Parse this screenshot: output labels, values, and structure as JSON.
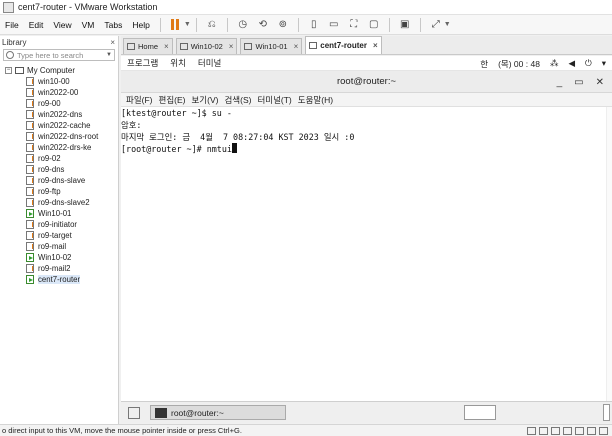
{
  "window": {
    "title": "cent7-router - VMware Workstation"
  },
  "menu": [
    "File",
    "Edit",
    "View",
    "VM",
    "Tabs",
    "Help"
  ],
  "library": {
    "title": "Library",
    "close_glyph": "×",
    "search_placeholder": "Type here to search",
    "root_label": "My Computer",
    "items": [
      {
        "label": "win10-00",
        "state": "off"
      },
      {
        "label": "win2022-00",
        "state": "off"
      },
      {
        "label": "ro9-00",
        "state": "off"
      },
      {
        "label": "win2022-dns",
        "state": "off"
      },
      {
        "label": "win2022-cache",
        "state": "off"
      },
      {
        "label": "win2022-dns-root",
        "state": "off"
      },
      {
        "label": "win2022-drs-ke",
        "state": "off"
      },
      {
        "label": "ro9-02",
        "state": "off"
      },
      {
        "label": "ro9-dns",
        "state": "off"
      },
      {
        "label": "ro9-dns-slave",
        "state": "off"
      },
      {
        "label": "ro9-ftp",
        "state": "off"
      },
      {
        "label": "ro9-dns-slave2",
        "state": "off"
      },
      {
        "label": "Win10-01",
        "state": "on"
      },
      {
        "label": "ro9-initiator",
        "state": "off"
      },
      {
        "label": "ro9-target",
        "state": "off"
      },
      {
        "label": "ro9-mail",
        "state": "off"
      },
      {
        "label": "Win10-02",
        "state": "on"
      },
      {
        "label": "ro9-mail2",
        "state": "off"
      },
      {
        "label": "cent7-router",
        "state": "on",
        "selected": true
      }
    ]
  },
  "tabs": [
    {
      "label": "Home",
      "active": false
    },
    {
      "label": "Win10-02",
      "active": false
    },
    {
      "label": "Win10-01",
      "active": false
    },
    {
      "label": "cent7-router",
      "active": true
    }
  ],
  "tab_close_glyph": "×",
  "gnome": {
    "apps": "프로그램",
    "places": "위치",
    "terminal": "터미널",
    "input_method": "한",
    "clock": "(목) 00 : 48"
  },
  "terminal": {
    "title": "root@router:~",
    "menu": [
      "파일(F)",
      "편집(E)",
      "보기(V)",
      "검색(S)",
      "터미널(T)",
      "도움말(H)"
    ],
    "lines": [
      "[ktest@router ~]$ su -",
      "암호:",
      "마지막 로그인: 금  4월  7 08:27:04 KST 2023 일시 :0",
      "[root@router ~]# nmtui"
    ]
  },
  "taskbar": {
    "item_label": "root@router:~"
  },
  "status": {
    "text": "o direct input to this VM, move the mouse pointer inside or press Ctrl+G."
  }
}
